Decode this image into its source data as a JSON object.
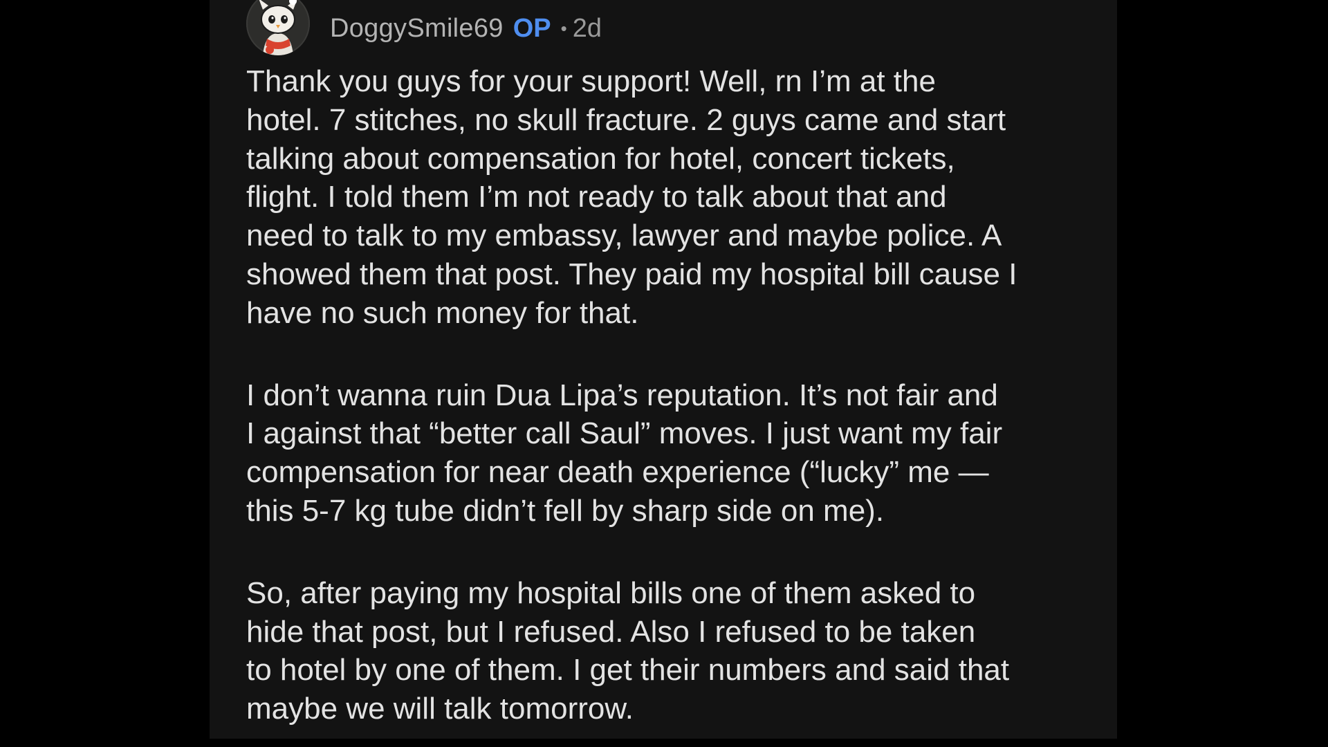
{
  "comment": {
    "author": "DoggySmile69",
    "badge": "OP",
    "separator": "•",
    "age": "2d",
    "avatar_icon": "snoo-avatar-icon",
    "paragraphs": [
      "Thank you guys for your support! Well, rn I’m at the\nhotel. 7 stitches, no skull fracture. 2 guys came and start\ntalking about compensation for hotel, concert tickets,\nflight. I told them I’m not ready to talk about that and\nneed to talk to my embassy, lawyer and maybe police. A\nshowed them that post. They paid my hospital bill cause I\nhave no such money for that.",
      "I don’t wanna ruin Dua Lipa’s reputation. It’s not fair and\nI against that “better call Saul” moves. I just want my fair\ncompensation for near death experience (“lucky” me —\nthis 5-7 kg tube didn’t fell by sharp side on me).",
      "So, after paying my hospital bills one of them asked to\nhide that post, but I refused. Also I refused to be taken\nto hotel by one of them. I get their numbers and said that\nmaybe we will talk tomorrow."
    ]
  },
  "colors": {
    "page_background": "#000000",
    "panel_background": "#131313",
    "body_text": "#e3e3e3",
    "username": "#b4b4b4",
    "op_badge": "#4f8ef0",
    "meta": "#9a9a9a"
  }
}
